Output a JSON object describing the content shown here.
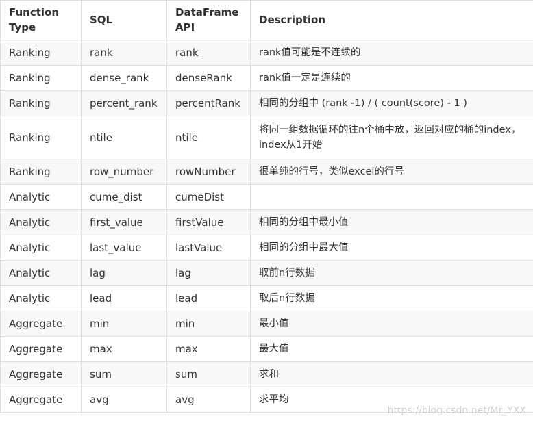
{
  "table": {
    "headers": [
      "Function Type",
      "SQL",
      "DataFrame API",
      "Description"
    ],
    "rows": [
      [
        "Ranking",
        "rank",
        "rank",
        "rank值可能是不连续的"
      ],
      [
        "Ranking",
        "dense_rank",
        "denseRank",
        "rank值一定是连续的"
      ],
      [
        "Ranking",
        "percent_rank",
        "percentRank",
        "相同的分组中 (rank -1) / ( count(score) - 1 )"
      ],
      [
        "Ranking",
        "ntile",
        "ntile",
        "将同一组数据循环的往n个桶中放，返回对应的桶的index，index从1开始"
      ],
      [
        "Ranking",
        "row_number",
        "rowNumber",
        "很单纯的行号，类似excel的行号"
      ],
      [
        "Analytic",
        "cume_dist",
        "cumeDist",
        ""
      ],
      [
        "Analytic",
        "first_value",
        "firstValue",
        "相同的分组中最小值"
      ],
      [
        "Analytic",
        "last_value",
        "lastValue",
        "相同的分组中最大值"
      ],
      [
        "Analytic",
        "lag",
        "lag",
        "取前n行数据"
      ],
      [
        "Analytic",
        "lead",
        "lead",
        "取后n行数据"
      ],
      [
        "Aggregate",
        "min",
        "min",
        "最小值"
      ],
      [
        "Aggregate",
        "max",
        "max",
        "最大值"
      ],
      [
        "Aggregate",
        "sum",
        "sum",
        "求和"
      ],
      [
        "Aggregate",
        "avg",
        "avg",
        "求平均"
      ]
    ]
  },
  "watermark": "https://blog.csdn.net/Mr_YXX"
}
